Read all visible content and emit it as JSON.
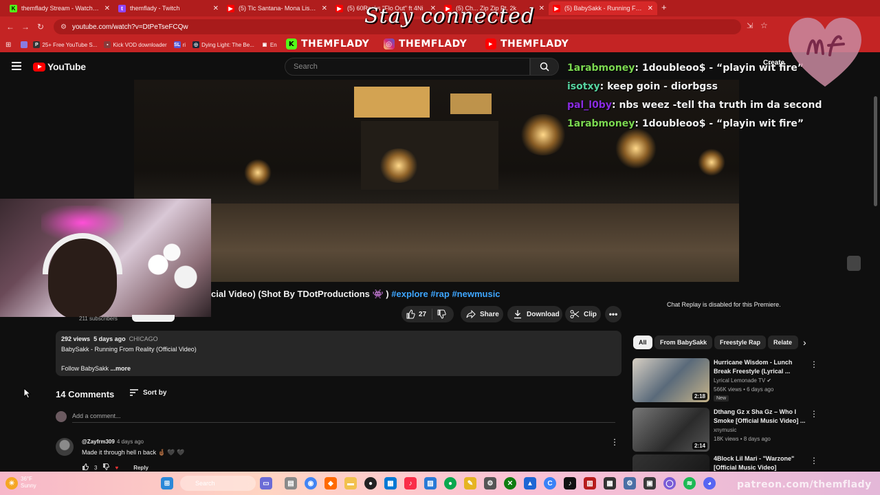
{
  "browser": {
    "tabs": [
      {
        "label": "themflady Stream - Watch Live",
        "icon": "kick-icon",
        "color": "#53fc18",
        "active": false
      },
      {
        "label": "themflady - Twitch",
        "icon": "twitch-icon",
        "color": "#9146ff",
        "active": false
      },
      {
        "label": "(5) Tlc Santana- Mona Lisa (@C",
        "icon": "youtube-icon",
        "color": "#ff0000",
        "active": false
      },
      {
        "label": "(5) 60Racks \"Flo Out\" ft 4Ni",
        "icon": "youtube-icon",
        "color": "#ff0000",
        "active": false
      },
      {
        "label": "(5) Ch... Zip Zip Pt. 2k",
        "icon": "youtube-icon",
        "color": "#ff0000",
        "active": false
      },
      {
        "label": "(5) BabySakk - Running From R",
        "icon": "youtube-icon",
        "color": "#ff0000",
        "active": true
      }
    ],
    "url": "youtube.com/watch?v=DtPeTseFCQw",
    "bookmarks": [
      {
        "label": "25+ Free YouTube S...",
        "icon": "p-icon",
        "color": "#333333"
      },
      {
        "label": "Kick VOD downloader",
        "icon": "kick-vod-icon",
        "color": "#8a3b3b"
      },
      {
        "label": "ri",
        "icon": "sl-icon",
        "color": "#5a5ad6"
      },
      {
        "label": "Dying Light: The Be...",
        "icon": "steam-icon",
        "color": "#1b2838"
      },
      {
        "label": "En",
        "icon": "bookmark-icon",
        "color": "#c42424"
      }
    ],
    "socials": [
      {
        "handle": "THEMFLADY",
        "icon": "kick-icon",
        "color": "#53fc18"
      },
      {
        "handle": "THEMFLADY",
        "icon": "instagram-icon",
        "color": "#d6249f"
      },
      {
        "handle": "THEMFLADY",
        "icon": "youtube-icon",
        "color": "#ff0000"
      }
    ]
  },
  "overlay": {
    "stay_connected": "Stay connected",
    "chat": [
      {
        "user": "1arabmoney",
        "user_color": "#7bd850",
        "message": ": 1doubleoo$ - “playin wit fire”"
      },
      {
        "user": "isotxy",
        "user_color": "#56d4a0",
        "message": ": keep goin - diorbgss"
      },
      {
        "user": "pal_l0by",
        "user_color": "#8a2be2",
        "message": ": nbs weez -tell tha truth im da second"
      },
      {
        "user": "1arabmoney",
        "user_color": "#7bd850",
        "message": ": 1doubleoo$ - “playin wit fire”"
      }
    ],
    "patreon": "patreon.com/themflady"
  },
  "youtube": {
    "logo": "YouTube",
    "search_placeholder": "Search",
    "create": "Create",
    "title_visible": "cial Video) (Shot By TDotProductions 👾 )",
    "hashtags": [
      "#explore",
      "#rap",
      "#newmusic"
    ],
    "subscribers": "211 subscribers",
    "likes": "27",
    "actions": {
      "share": "Share",
      "download": "Download",
      "clip": "Clip"
    },
    "description": {
      "views": "292 views",
      "age": "5 days ago",
      "location": "CHICAGO",
      "line1": "BabySakk - Running From Reality (Official Video)",
      "line2": "Follow BabySakk",
      "more": "...more"
    },
    "comments": {
      "count": "14 Comments",
      "sort": "Sort by",
      "add_placeholder": "Add a comment...",
      "items": [
        {
          "author": "@Zayfrm309",
          "age": "4 days ago",
          "text": "Made it through hell n back 🤞🏾 🖤 🖤",
          "likes": "3",
          "reply": "Reply"
        }
      ]
    },
    "chat_disabled": "Chat Replay is disabled for this Premiere.",
    "chips": [
      {
        "label": "All",
        "active": true
      },
      {
        "label": "From BabySakk",
        "active": false
      },
      {
        "label": "Freestyle Rap",
        "active": false
      },
      {
        "label": "Relate",
        "active": false
      }
    ],
    "recommendations": [
      {
        "title": "Hurricane Wisdom - Lunch Break Freestyle (Lyrical ...",
        "channel": "Lyrical Lemonade TV",
        "views": "566K views",
        "age": "6 days ago",
        "duration": "2:18",
        "badge": "New",
        "verified": true
      },
      {
        "title": "Dthang Gz x Sha Gz – Who I Smoke [Official Music Video] ...",
        "channel": "xnymusic",
        "views": "18K views",
        "age": "8 days ago",
        "duration": "2:14",
        "badge": "",
        "verified": false
      },
      {
        "title": "4Block Lil Mari - \"Warzone\" [Official Music Video]",
        "channel": "",
        "views": "",
        "age": "",
        "duration": "",
        "badge": "",
        "verified": false
      }
    ]
  },
  "taskbar": {
    "search": "Search",
    "weather_temp": "36°F",
    "weather_desc": "Sunny"
  }
}
